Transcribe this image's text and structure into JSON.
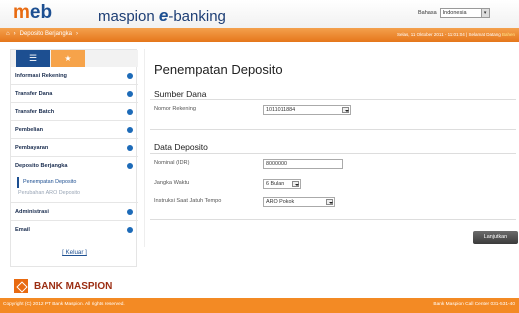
{
  "header": {
    "logo_m": "m",
    "logo_eb": "eb",
    "brand_prefix": "maspion",
    "brand_e": "e",
    "brand_suffix": "-banking",
    "lang_label": "Bahasa",
    "lang_value": "Indonesia"
  },
  "nav": {
    "home_icon": "home-icon",
    "breadcrumb": "Deposito Berjangka",
    "session_info_prefix": "Selas, 11 Oktober 2011 - 11:01:04 |",
    "user_label": "Selamat Datang",
    "user_name": "Bahen"
  },
  "sidebar": {
    "items": [
      {
        "label": "Informasi Rekening"
      },
      {
        "label": "Transfer Dana"
      },
      {
        "label": "Transfer Batch"
      },
      {
        "label": "Pembelian"
      },
      {
        "label": "Pembayaran"
      },
      {
        "label": "Deposito Berjangka"
      },
      {
        "label": "Administrasi"
      },
      {
        "label": "Email"
      }
    ],
    "subitems": [
      {
        "label": "Penempatan Deposito"
      },
      {
        "label": "Perubahan ARO Deposito"
      }
    ],
    "logout": "[ Keluar ]"
  },
  "main": {
    "title": "Penempatan Deposito",
    "section_source": "Sumber Dana",
    "account_label": "Nomor Rekening",
    "account_value": "1011011884",
    "section_deposit": "Data Deposito",
    "nominal_label": "Nominal (IDR)",
    "nominal_value": "8000000",
    "term_label": "Jangka Waktu",
    "term_value": "6 Bulan",
    "instruction_label": "Instruksi Saat Jatuh Tempo",
    "instruction_value": "ARO Pokok",
    "next_button": "Lanjutkan"
  },
  "bank": {
    "name": "BANK MASPION"
  },
  "footer": {
    "copyright": "Copyright (C) 2012 PT Bank Maspion. All rights reserved.",
    "call_center": "Bank Maspion Call Center 031-531-40"
  },
  "colors": {
    "accent": "#f38a24",
    "brand_blue": "#1d4f91"
  }
}
